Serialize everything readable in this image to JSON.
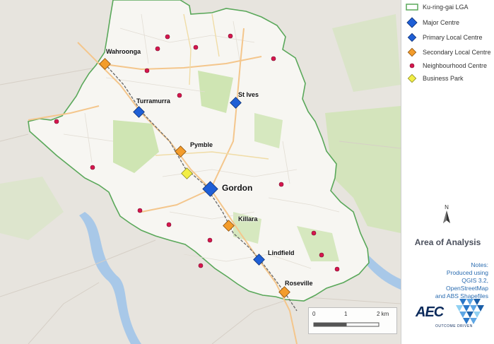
{
  "legend": {
    "items": [
      {
        "label": "Ku-ring-gai LGA",
        "symbol": "lga-boundary",
        "color": "#5aa85a"
      },
      {
        "label": "Major Centre",
        "symbol": "diamond",
        "color": "#1f5fd6"
      },
      {
        "label": "Primary Local Centre",
        "symbol": "diamond",
        "color": "#1f5fd6"
      },
      {
        "label": "Secondary Local Centre",
        "symbol": "diamond",
        "color": "#f39c2b"
      },
      {
        "label": "Neighbourhood Centre",
        "symbol": "circle",
        "color": "#d6164e"
      },
      {
        "label": "Business Park",
        "symbol": "diamond",
        "color": "#f2ee45"
      }
    ]
  },
  "north_label": "N",
  "title": "Area of Analysis",
  "notes": [
    "Notes:",
    "Produced using",
    "QGIS 3.2,",
    "OpenStreetMap",
    "and ABS Shapefiles"
  ],
  "logo": {
    "name": "AEC",
    "tagline": "OUTCOME DRIVEN"
  },
  "scale": {
    "labels": [
      "0",
      "1",
      "2 km"
    ]
  },
  "places": [
    {
      "name": "Wahroonga",
      "type": "secondary"
    },
    {
      "name": "Turramurra",
      "type": "primary"
    },
    {
      "name": "St Ives",
      "type": "primary"
    },
    {
      "name": "Pymble",
      "type": "secondary"
    },
    {
      "name": "Gordon",
      "type": "major"
    },
    {
      "name": "Killara",
      "type": "secondary"
    },
    {
      "name": "Lindfield",
      "type": "primary"
    },
    {
      "name": "Roseville",
      "type": "secondary"
    }
  ],
  "colors": {
    "map_bg": "#e9e7e2",
    "lga_fill": "#f6f5f1",
    "lga_border": "#5aa85a",
    "park": "#cfe5b3",
    "road": "#f4c68c",
    "rail": "#777777",
    "water": "#a8c8e8"
  }
}
